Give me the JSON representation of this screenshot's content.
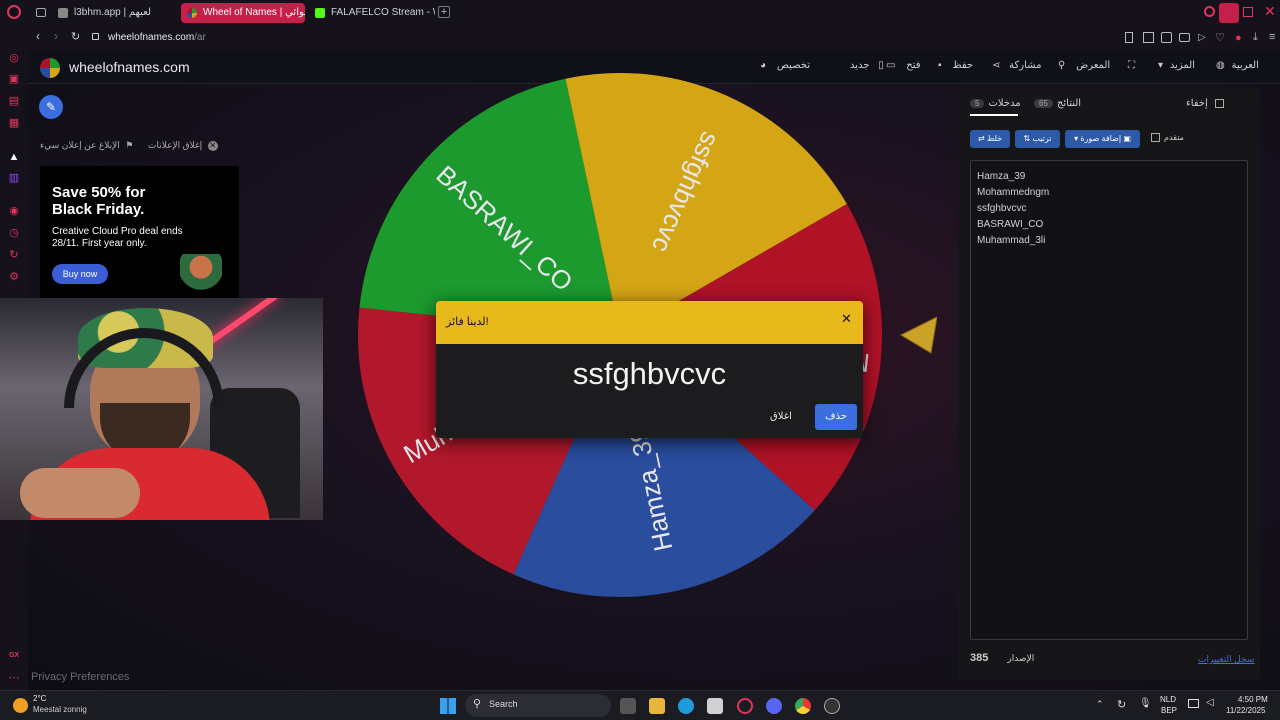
{
  "browser": {
    "tabs": [
      {
        "label": "l3bhm.app | لعبهم"
      },
      {
        "label": "Wheel of Names | عشوائي"
      },
      {
        "label": "FALAFELCO Stream - Wat"
      }
    ],
    "url_host": "wheelofnames.com",
    "url_path": "/ar"
  },
  "site": {
    "logo_text": "wheelofnames.com",
    "nav": {
      "customize": "تخصيص",
      "new": "جديد",
      "open": "فتح",
      "save": "حفظ",
      "share": "مشاركة",
      "gallery": "المعرض",
      "more": "المزيد",
      "language": "العربية"
    },
    "ad_controls": {
      "report": "الإبلاغ عن إعلان سيء",
      "close_ads": "إغلاق الإعلانات"
    },
    "ad": {
      "headline": "Save 50% for Black Friday.",
      "body": "Creative Cloud Pro deal ends 28/11. First year only.",
      "cta": "Buy now"
    },
    "footer": {
      "privacy": "Privacy Preferences"
    }
  },
  "wheel": {
    "segments": [
      {
        "label": "BASRAWI_CO",
        "color": "#1c9a2e"
      },
      {
        "label": "ssfghbvcvc",
        "color": "#d4a514"
      },
      {
        "label": "Mohammedngm",
        "color": "#b01226"
      },
      {
        "label": "Hamza_39",
        "color": "#2a4d9e"
      },
      {
        "label": "Muhammad_3li",
        "color": "#b2182b"
      }
    ]
  },
  "panel": {
    "hide_label": "إخفاء",
    "tab_entries": "مدخلات",
    "tab_entries_count": "5",
    "tab_results": "النتائج",
    "tab_results_count": "65",
    "shuffle": "خلط",
    "sort": "ترتيب",
    "add_image": "إضافة صورة",
    "advanced": "متقدم",
    "entries": [
      "Hamza_39",
      "Mohammedngm",
      "ssfghbvcvc",
      "BASRAWI_CO",
      "Muhammad_3li"
    ],
    "version_label": "الإصدار",
    "version_number": "385",
    "changelog": "سجل التغييرات"
  },
  "modal": {
    "title": "لدينا فائز!",
    "winner": "ssfghbvcvc",
    "remove": "حذف",
    "close": "اغلاق"
  },
  "taskbar": {
    "weather_temp": "2°C",
    "weather_desc": "Meestal zonnig",
    "search": "Search",
    "lang1": "NLD",
    "lang2": "BEP",
    "time": "4:50 PM",
    "date": "11/22/2025"
  },
  "colors": {
    "modal_header": "#e8b91a",
    "button_blue": "#3b6fe0",
    "accent_red": "#e0355a"
  }
}
